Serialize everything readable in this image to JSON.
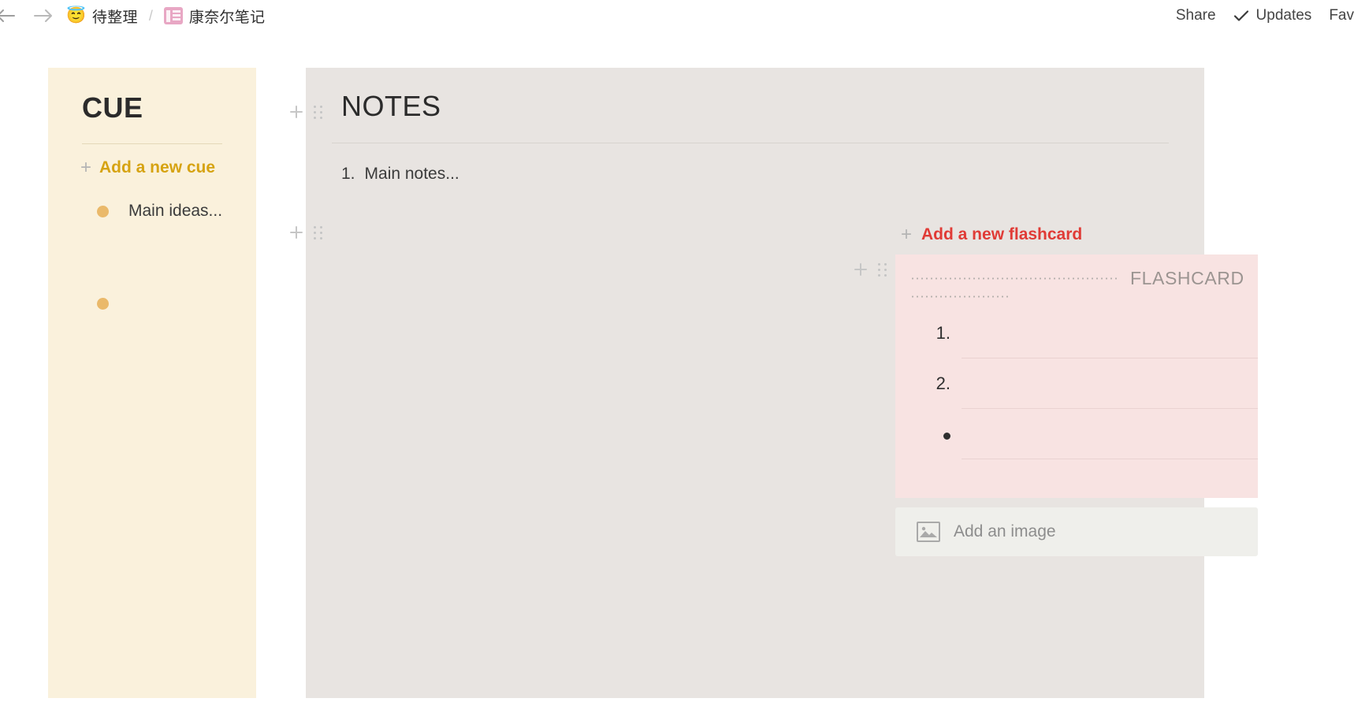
{
  "topbar": {
    "nav": {
      "back": "back-arrow",
      "forward": "forward-arrow"
    },
    "breadcrumb": {
      "parent": {
        "emoji": "😇",
        "label": "待整理"
      },
      "separator": "/",
      "current": {
        "icon": "notebook-icon",
        "label": "康奈尔笔记"
      }
    },
    "actions": {
      "share": "Share",
      "updates": "Updates",
      "favorites": "Fav"
    }
  },
  "cue": {
    "title": "CUE",
    "add_label": "Add a new cue",
    "items": [
      {
        "text": "Main ideas..."
      },
      {
        "text": ""
      }
    ]
  },
  "notes": {
    "title": "NOTES",
    "items": [
      {
        "number": "1.",
        "text": "Main notes..."
      }
    ]
  },
  "flashcard": {
    "add_label": "Add a new flashcard",
    "label": "FLASHCARD",
    "items": [
      {
        "marker": "1.",
        "text": ""
      },
      {
        "marker": "2.",
        "text": ""
      },
      {
        "marker": "•",
        "text": ""
      }
    ],
    "add_image_label": "Add an image"
  },
  "colors": {
    "cue_bg": "#faf1dc",
    "cue_accent": "#d6a312",
    "cue_bullet": "#eab96a",
    "notes_bg": "#e8e4e1",
    "flashcard_bg": "#f8e3e2",
    "flashcard_accent": "#e03b36",
    "add_image_bg": "#efefeb"
  }
}
